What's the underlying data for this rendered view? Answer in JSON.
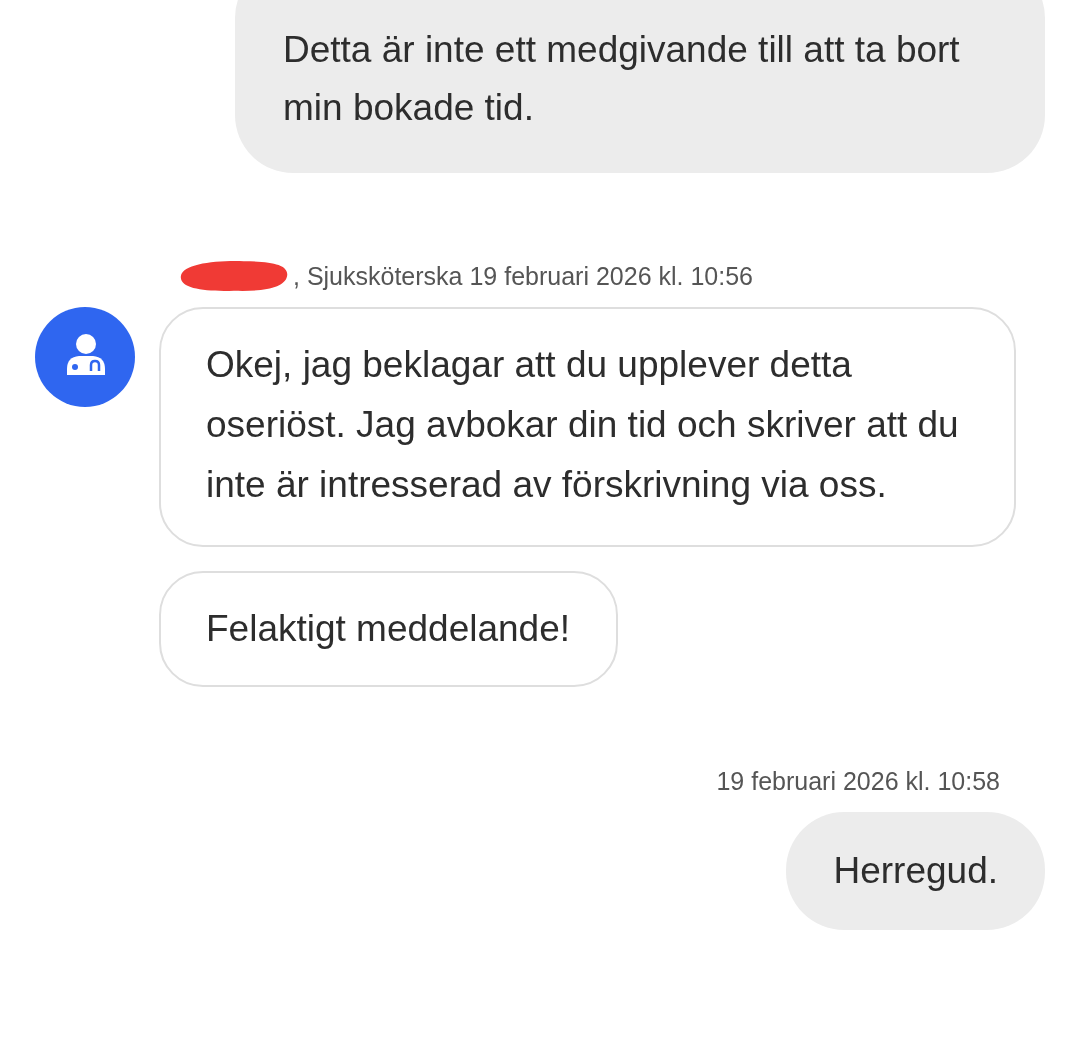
{
  "messages": [
    {
      "kind": "sent",
      "bubbles": [
        "Detta är inte ett medgivande till att ta bort min bokade tid."
      ]
    },
    {
      "kind": "received",
      "redacted": true,
      "meta": ", Sjuksköterska 19 februari 2026 kl. 10:56",
      "bubbles": [
        "Okej, jag beklagar att du upplever detta oseriöst. Jag avbokar din tid och skriver att du inte är intresserad av förskrivning via oss.",
        "Felaktigt meddelande!"
      ]
    },
    {
      "kind": "sent",
      "meta": "19 februari 2026 kl. 10:58",
      "bubbles": [
        "Herregud."
      ]
    }
  ]
}
